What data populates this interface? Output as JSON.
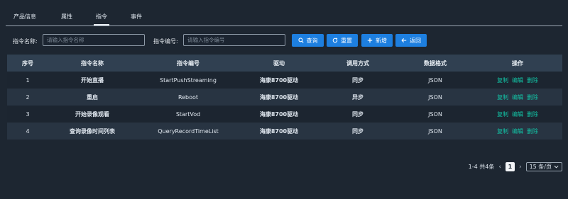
{
  "tabs": [
    {
      "label": "产品信息"
    },
    {
      "label": "属性"
    },
    {
      "label": "指令"
    },
    {
      "label": "事件"
    }
  ],
  "filters": {
    "name_label": "指令名称:",
    "name_placeholder": "请输入指令名称",
    "code_label": "指令编号:",
    "code_placeholder": "请输入指令编号"
  },
  "buttons": {
    "search": "查询",
    "reset": "重置",
    "add": "新增",
    "back": "返回"
  },
  "colors": {
    "accent": "#1d7fe0",
    "link": "#12c3a5",
    "background": "#1d2631"
  },
  "table": {
    "headers": [
      "序号",
      "指令名称",
      "指令编号",
      "驱动",
      "调用方式",
      "数据格式",
      "操作"
    ],
    "rows": [
      {
        "index": "1",
        "name": "开始直播",
        "code": "StartPushStreaming",
        "driver": "海康8700驱动",
        "call": "同步",
        "format": "JSON"
      },
      {
        "index": "2",
        "name": "重启",
        "code": "Reboot",
        "driver": "海康8700驱动",
        "call": "异步",
        "format": "JSON"
      },
      {
        "index": "3",
        "name": "开始录像观看",
        "code": "StartVod",
        "driver": "海康8700驱动",
        "call": "同步",
        "format": "JSON"
      },
      {
        "index": "4",
        "name": "查询录像时间列表",
        "code": "QueryRecordTimeList",
        "driver": "海康8700驱动",
        "call": "同步",
        "format": "JSON"
      }
    ],
    "actions": {
      "copy": "复制",
      "edit": "编辑",
      "delete": "删除"
    }
  },
  "pagination": {
    "summary": "1-4 共4条",
    "prev": "‹",
    "current": "1",
    "next": "›",
    "page_size": "15 条/页"
  }
}
